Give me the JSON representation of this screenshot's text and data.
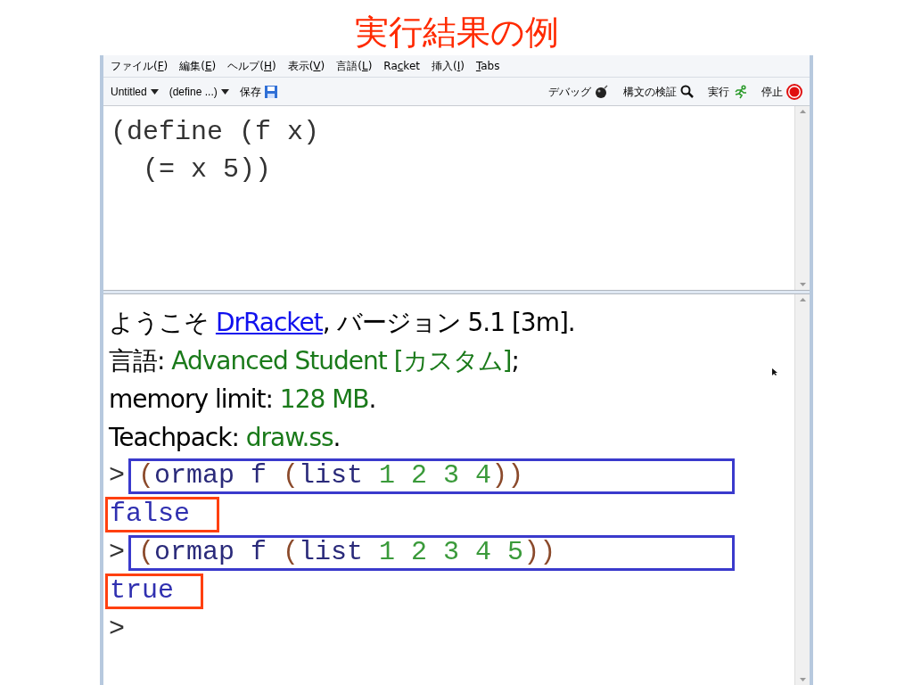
{
  "slide_title": "実行結果の例",
  "menu_bar": [
    {
      "before": "ファイル(",
      "mnemonic": "F",
      "after": ")"
    },
    {
      "before": "編集(",
      "mnemonic": "E",
      "after": ")"
    },
    {
      "before": "ヘルプ(",
      "mnemonic": "H",
      "after": ")"
    },
    {
      "before": "表示(",
      "mnemonic": "V",
      "after": ")"
    },
    {
      "before": "言語(",
      "mnemonic": "L",
      "after": ")"
    },
    {
      "before": "Ra",
      "mnemonic": "c",
      "after": "ket"
    },
    {
      "before": "挿入(",
      "mnemonic": "I",
      "after": ")"
    },
    {
      "mnemonic": "T",
      "after": "abs"
    }
  ],
  "toolbar": {
    "left": [
      {
        "kind": "dropdown",
        "label": "Untitled"
      },
      {
        "kind": "dropdown",
        "label": "(define ...)"
      },
      {
        "kind": "save",
        "label": "保存"
      }
    ],
    "right": [
      {
        "kind": "debug",
        "label": "デバッグ"
      },
      {
        "kind": "check",
        "label": "構文の検証"
      },
      {
        "kind": "run",
        "label": "実行"
      },
      {
        "kind": "stop",
        "label": "停止"
      }
    ]
  },
  "definitions": [
    "(define (f x)",
    "  (= x 5))"
  ],
  "welcome": [
    [
      {
        "kind": "plain",
        "text": "ようこそ "
      },
      {
        "kind": "link",
        "text": "DrRacket"
      },
      {
        "kind": "plain",
        "text": ", バージョン 5.1 [3m]."
      }
    ],
    [
      {
        "kind": "plain",
        "text": "言語: "
      },
      {
        "kind": "green",
        "text": "Advanced Student [カスタム]"
      },
      {
        "kind": "plain",
        "text": ";"
      }
    ],
    [
      {
        "kind": "plain",
        "text": "memory limit: "
      },
      {
        "kind": "green",
        "text": "128 MB"
      },
      {
        "kind": "plain",
        "text": "."
      }
    ],
    [
      {
        "kind": "plain",
        "text": "Teachpack: "
      },
      {
        "kind": "green",
        "text": "draw.ss"
      },
      {
        "kind": "plain",
        "text": "."
      }
    ]
  ],
  "interactions": [
    {
      "prompt": ">",
      "expression": [
        {
          "kind": "paren",
          "text": "("
        },
        {
          "kind": "symbol",
          "text": "ormap f "
        },
        {
          "kind": "paren",
          "text": "("
        },
        {
          "kind": "symbol",
          "text": "list "
        },
        {
          "kind": "number",
          "text": "1 2 3 4"
        },
        {
          "kind": "paren",
          "text": "))"
        }
      ],
      "expression_highlighted": true,
      "result": "false",
      "result_highlighted": true
    },
    {
      "prompt": ">",
      "expression": [
        {
          "kind": "paren",
          "text": "("
        },
        {
          "kind": "symbol",
          "text": "ormap f "
        },
        {
          "kind": "paren",
          "text": "("
        },
        {
          "kind": "symbol",
          "text": "list "
        },
        {
          "kind": "number",
          "text": "1 2 3 4 5"
        },
        {
          "kind": "paren",
          "text": "))"
        }
      ],
      "expression_highlighted": true,
      "result": "true",
      "result_highlighted": true
    }
  ],
  "final_prompt": ">"
}
